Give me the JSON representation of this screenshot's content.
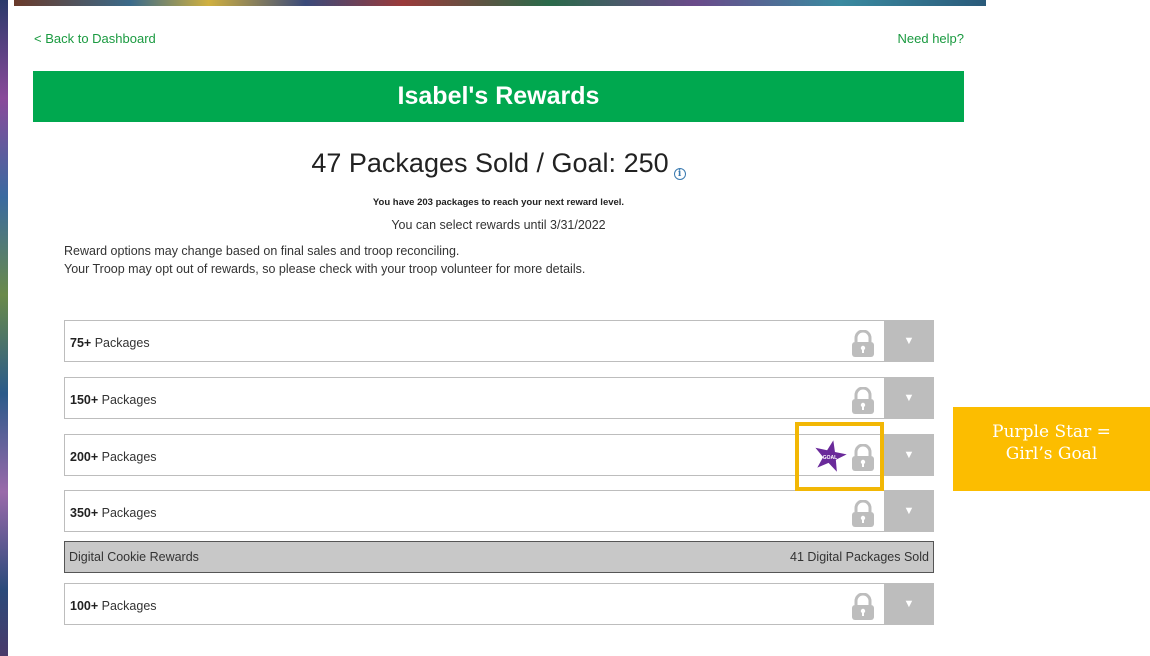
{
  "nav": {
    "back_label": "< Back to Dashboard",
    "help_label": "Need help?"
  },
  "banner": {
    "title": "Isabel's Rewards"
  },
  "summary": {
    "headline": "47 Packages Sold / Goal: 250",
    "packages_sold": 47,
    "goal": 250,
    "next_level_text": "You have 203 packages to reach your next reward level.",
    "deadline_text": "You can select rewards until 3/31/2022",
    "note_1": "Reward options may change based on final sales and troop reconciling.",
    "note_2": "Your Troop may opt out of rewards, so please check with your troop volunteer for more details."
  },
  "rewards": [
    {
      "threshold": "75+",
      "suffix": " Packages",
      "locked": true,
      "goal": false
    },
    {
      "threshold": "150+",
      "suffix": " Packages",
      "locked": true,
      "goal": false
    },
    {
      "threshold": "200+",
      "suffix": " Packages",
      "locked": true,
      "goal": true
    },
    {
      "threshold": "350+",
      "suffix": " Packages",
      "locked": true,
      "goal": false
    }
  ],
  "digital": {
    "label": "Digital Cookie Rewards",
    "sold_text": "41 Digital Packages Sold",
    "rewards": [
      {
        "threshold": "100+",
        "suffix": " Packages",
        "locked": true,
        "goal": false
      }
    ]
  },
  "goal_badge": {
    "text": "GOAL",
    "color": "#6a2a9a"
  },
  "legend": {
    "line_1": "Purple Star =",
    "line_2": "Girl’s Goal",
    "color": "#fcbd00"
  },
  "colors": {
    "brand_green": "#00a84f",
    "link_green": "#1a9a40",
    "lock_gray": "#bdbdbd",
    "highlight": "#f2b705"
  },
  "icons": {
    "info": "info-icon",
    "lock": "lock-icon",
    "dropdown": "chevron-down-icon",
    "goal": "goal-star-icon"
  }
}
